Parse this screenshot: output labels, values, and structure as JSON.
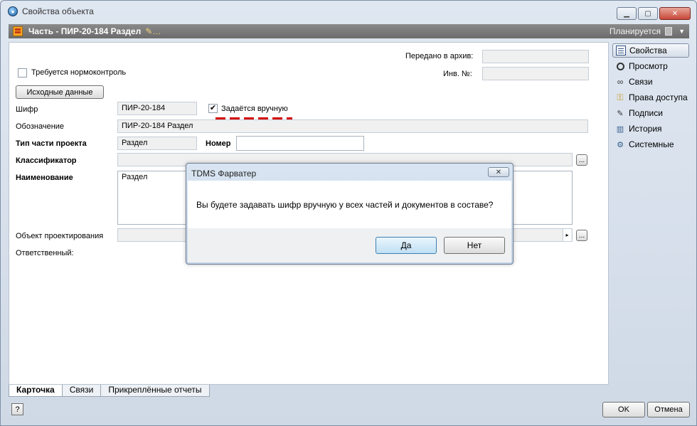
{
  "window": {
    "title": "Свойства объекта",
    "minimize": "▁",
    "maximize": "▢",
    "close": "✕"
  },
  "object_bar": {
    "title": "Часть - ПИР-20-184 Раздел",
    "status": "Планируется"
  },
  "form": {
    "archive_label": "Передано в архив:",
    "archive_value": "",
    "inv_label": "Инв. №:",
    "inv_value": "",
    "norm_check_label": "Требуется нормоконтроль",
    "source_data_button": "Исходные данные",
    "cipher_label": "Шифр",
    "cipher_value": "ПИР-20-184",
    "manual_label": "Задаётся вручную",
    "manual_checked": "✔",
    "designation_label": "Обозначение",
    "designation_value": "ПИР-20-184 Раздел",
    "part_type_label": "Тип части проекта",
    "part_type_value": "Раздел",
    "number_label": "Номер",
    "number_value": "",
    "classifier_label": "Классификатор",
    "classifier_value": "",
    "name_label": "Наименование",
    "name_value": "Раздел",
    "design_object_label": "Объект проектирования",
    "design_object_value": "",
    "responsible_label": "Ответственный:",
    "ellipsis": "...",
    "combo_arrow": "▸"
  },
  "tabs": [
    {
      "label": "Карточка"
    },
    {
      "label": "Связи"
    },
    {
      "label": "Прикреплённые отчеты"
    }
  ],
  "side_panel": [
    {
      "label": "Свойства",
      "icon": "properties-icon"
    },
    {
      "label": "Просмотр",
      "icon": "search-icon"
    },
    {
      "label": "Связи",
      "icon": "link-icon"
    },
    {
      "label": "Права доступа",
      "icon": "key-icon"
    },
    {
      "label": "Подписи",
      "icon": "signature-icon"
    },
    {
      "label": "История",
      "icon": "history-icon"
    },
    {
      "label": "Системные",
      "icon": "system-icon"
    }
  ],
  "footer": {
    "help": "?",
    "ok": "OK",
    "cancel": "Отмена"
  },
  "dialog": {
    "title": "TDMS Фарватер",
    "close": "✕",
    "message": "Вы будете задавать шифр вручную у всех частей и документов в составе?",
    "yes": "Да",
    "no": "Нет"
  }
}
